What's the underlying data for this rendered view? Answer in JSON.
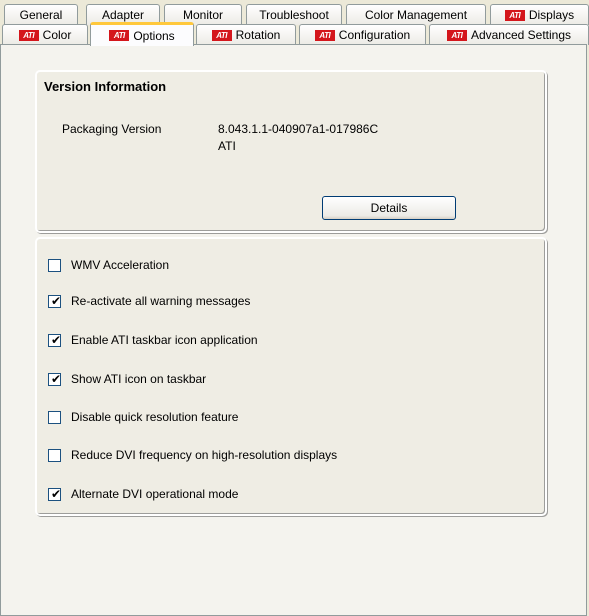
{
  "tabs_row1": [
    {
      "label": "General",
      "ati": false
    },
    {
      "label": "Adapter",
      "ati": false
    },
    {
      "label": "Monitor",
      "ati": false
    },
    {
      "label": "Troubleshoot",
      "ati": false
    },
    {
      "label": "Color Management",
      "ati": false
    },
    {
      "label": "Displays",
      "ati": true
    }
  ],
  "tabs_row2": [
    {
      "label": "Color",
      "ati": true
    },
    {
      "label": "Options",
      "ati": true,
      "active": true
    },
    {
      "label": "Rotation",
      "ati": true
    },
    {
      "label": "Configuration",
      "ati": true
    },
    {
      "label": "Advanced Settings",
      "ati": true
    }
  ],
  "ati_logo_text": "ATI",
  "version": {
    "title": "Version Information",
    "packaging_label": "Packaging Version",
    "packaging_value": "8.043.1.1-040907a1-017986C",
    "vendor": "ATI",
    "details_button": "Details"
  },
  "options": [
    {
      "label": "WMV Acceleration",
      "checked": false
    },
    {
      "label": "Re-activate all warning messages",
      "checked": true
    },
    {
      "label": "Enable ATI taskbar icon application",
      "checked": true
    },
    {
      "label": "Show ATI icon on taskbar",
      "checked": true
    },
    {
      "label": "Disable quick resolution feature",
      "checked": false
    },
    {
      "label": "Reduce DVI frequency on high-resolution displays",
      "checked": false
    },
    {
      "label": "Alternate DVI operational mode",
      "checked": true
    }
  ],
  "check_glyph": "✔"
}
